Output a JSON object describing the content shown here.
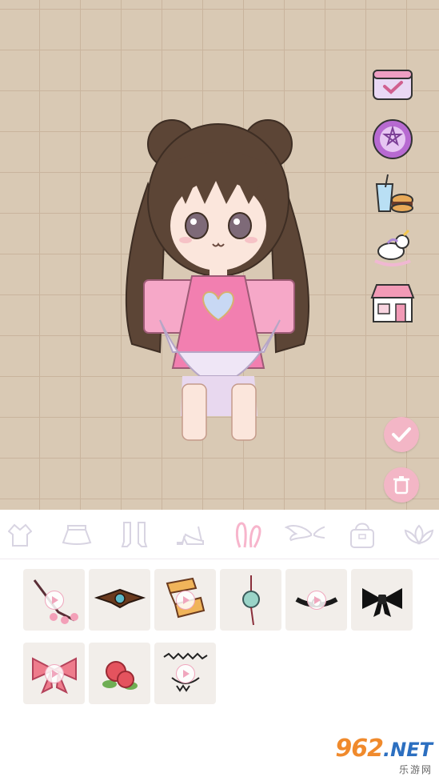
{
  "colors": {
    "stage_background": "#d9c9b4",
    "grid_line": "#c9b49d",
    "accent_pink": "#f3b6c6",
    "tab_icon": "#d8d4e2",
    "item_tile": "#f2eeea"
  },
  "side_menu": [
    {
      "name": "calendar-check-icon"
    },
    {
      "name": "magic-star-badge-icon"
    },
    {
      "name": "drink-burger-icon"
    },
    {
      "name": "unicorn-rocking-icon"
    },
    {
      "name": "shop-icon"
    }
  ],
  "actions": [
    {
      "name": "confirm-check-icon"
    },
    {
      "name": "trash-icon"
    }
  ],
  "category_tabs": [
    {
      "name": "jacket-icon",
      "selected": false
    },
    {
      "name": "skirt-icon",
      "selected": false
    },
    {
      "name": "socks-icon",
      "selected": false
    },
    {
      "name": "high-heel-icon",
      "selected": false
    },
    {
      "name": "bunny-ears-icon",
      "selected": true
    },
    {
      "name": "wings-icon",
      "selected": false
    },
    {
      "name": "handbag-icon",
      "selected": false
    },
    {
      "name": "lotus-icon",
      "selected": false
    }
  ],
  "items": [
    {
      "name": "sakura-branch-accessory",
      "video_locked": true
    },
    {
      "name": "gem-collar-accessory",
      "video_locked": false
    },
    {
      "name": "gold-armband-accessory",
      "video_locked": true
    },
    {
      "name": "charm-pendant-accessory",
      "video_locked": false
    },
    {
      "name": "black-choker-accessory",
      "video_locked": true
    },
    {
      "name": "black-bow-accessory",
      "video_locked": false
    },
    {
      "name": "pink-bow-accessory",
      "video_locked": true
    },
    {
      "name": "red-rose-accessory",
      "video_locked": false
    },
    {
      "name": "lace-necklace-accessory",
      "video_locked": true
    }
  ],
  "watermark": {
    "number": "962",
    "domain": ".NET",
    "chinese": "乐游网"
  }
}
